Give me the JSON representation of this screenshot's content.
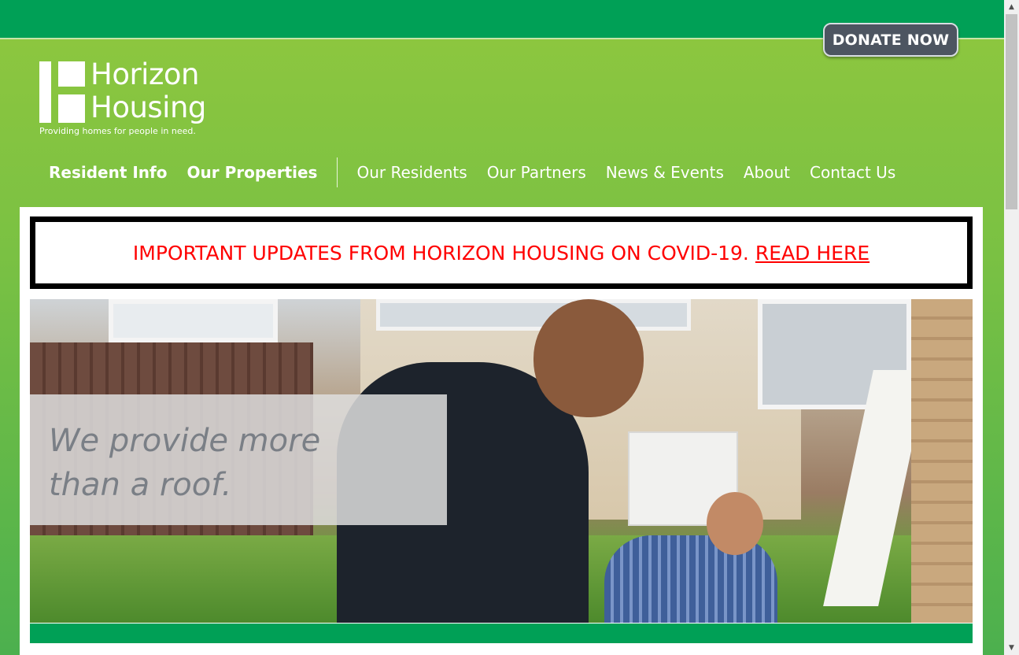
{
  "header": {
    "donate_label": "DONATE NOW",
    "logo": {
      "name_line1": "Horizon",
      "name_line2": "Housing",
      "tagline": "Providing homes for people in need."
    },
    "nav": {
      "primary": [
        "Resident Info",
        "Our Properties"
      ],
      "secondary": [
        "Our Residents",
        "Our Partners",
        "News & Events",
        "About",
        "Contact Us"
      ]
    }
  },
  "alert": {
    "text": "IMPORTANT UPDATES FROM HORIZON HOUSING ON COVID-19.",
    "link_label": "READ HERE"
  },
  "hero": {
    "tagline_line1": "We provide more",
    "tagline_line2": "than a roof."
  },
  "colors": {
    "top_bar": "#00a056",
    "header_green": "#8cc63f",
    "donate_bg": "#4d5561",
    "alert_text": "#ff0000"
  },
  "icons": {
    "scroll_up": "scroll-up-arrow-icon",
    "scroll_down": "scroll-down-arrow-icon"
  }
}
